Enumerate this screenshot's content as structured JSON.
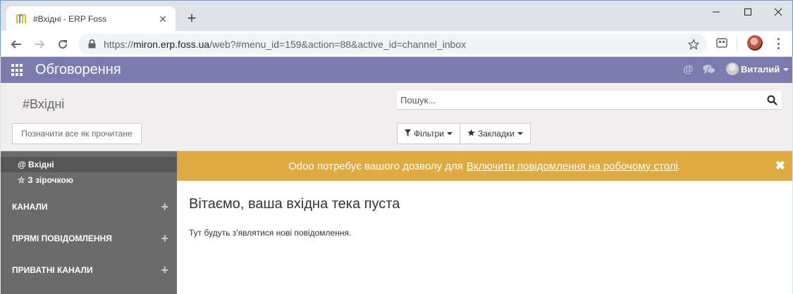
{
  "browser": {
    "tab_title": "#Вхідні - ERP Foss",
    "url_host": "miron.erp.foss.ua",
    "url_prefix": "https://",
    "url_path": "/web?#menu_id=159&action=88&active_id=channel_inbox",
    "new_tab_glyph": "+",
    "close_tab_glyph": "✕"
  },
  "odoo_nav": {
    "app_title": "Обговорення",
    "at_glyph": "@",
    "user_name": "Виталий"
  },
  "control_panel": {
    "breadcrumb": "#Вхідні",
    "mark_all_read": "Позначити все як прочитане",
    "search_placeholder": "Пошук...",
    "filters_label": "Фільтри",
    "bookmarks_label": "Закладки"
  },
  "sidebar": {
    "inbox_label": "@ Вхідні",
    "starred_label": "☆ З зірочкою",
    "sections": [
      {
        "label": "КАНАЛИ"
      },
      {
        "label": "ПРЯМІ ПОВІДОМЛЕННЯ"
      },
      {
        "label": "ПРИВАТНІ КАНАЛИ"
      }
    ],
    "plus_glyph": "+"
  },
  "notification": {
    "text": "Odoo потребує вашого дозволу для",
    "link": "Включити повідомлення на робочому столі",
    "suffix": ".",
    "close_glyph": "✖"
  },
  "empty_state": {
    "title": "Вітаємо, ваша вхідна тека пуста",
    "text": "Тут будуть з'являтися нові повідомлення."
  },
  "colors": {
    "odoo_nav": "#7c7bad",
    "notification_bar": "#e0aa43",
    "sidebar": "#6b6b6b",
    "control_panel": "#f0eeee"
  }
}
